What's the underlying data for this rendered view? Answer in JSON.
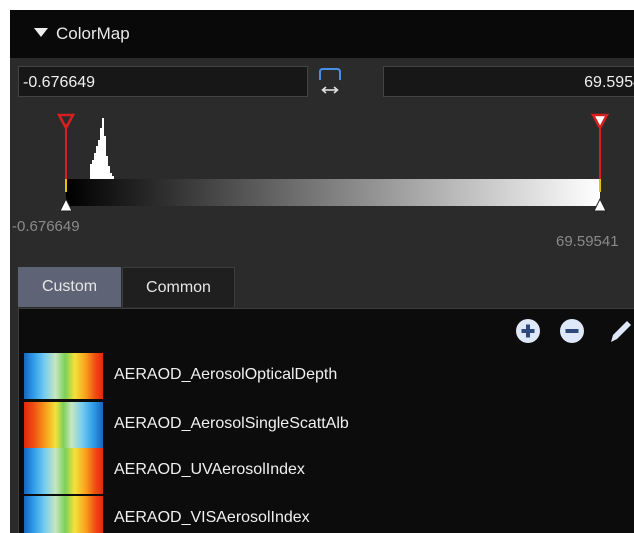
{
  "header": {
    "title": "ColorMap"
  },
  "range": {
    "min_value": "-0.676649",
    "max_value": "69.5954",
    "min_label": "-0.676649",
    "max_label": "69.59541"
  },
  "colors": {
    "marker_red": "#d61f1f",
    "accent_blue": "#4a8fe7",
    "tab_active": "#5e6475"
  },
  "tabs": [
    {
      "label": "Custom",
      "active": true
    },
    {
      "label": "Common",
      "active": false
    }
  ],
  "toolbar": {
    "icons": [
      "add-icon",
      "remove-icon",
      "edit-icon"
    ]
  },
  "colormaps": [
    {
      "name": "AERAOD_AerosolOpticalDepth",
      "swatch": "rainbow"
    },
    {
      "name": "AERAOD_AerosolSingleScattAlb",
      "swatch": "reversed-rainbow"
    },
    {
      "name": "AERAOD_UVAerosolIndex",
      "swatch": "rainbow"
    },
    {
      "name": "AERAOD_VISAerosolIndex",
      "swatch": "rainbow"
    }
  ]
}
